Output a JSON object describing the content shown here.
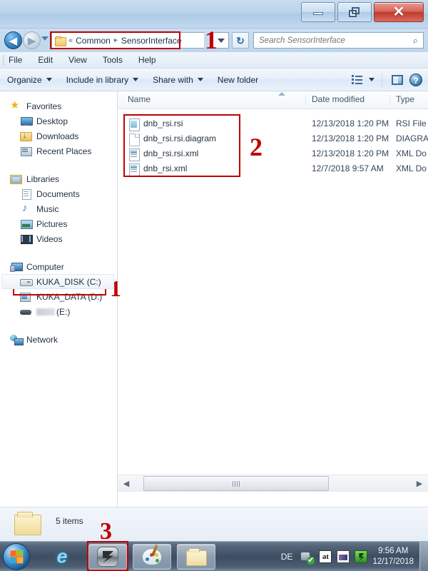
{
  "window": {
    "buttons": {
      "minimize": "minimize",
      "maximize": "maximize",
      "close": "close",
      "close_glyph": "✕"
    }
  },
  "address_bar": {
    "back_glyph": "◀",
    "forward_glyph": "▶",
    "chevrons": "«",
    "crumbs": [
      "Common",
      "SensorInterface"
    ],
    "separator": "▸",
    "refresh_glyph": "↻"
  },
  "search": {
    "placeholder": "Search SensorInterface",
    "value": "",
    "icon_glyph": "⌕"
  },
  "menubar": {
    "items": [
      "File",
      "Edit",
      "View",
      "Tools",
      "Help"
    ]
  },
  "toolbar": {
    "items": [
      {
        "label": "Organize",
        "has_caret": true
      },
      {
        "label": "Include in library",
        "has_caret": true
      },
      {
        "label": "Share with",
        "has_caret": true
      },
      {
        "label": "New folder",
        "has_caret": false
      }
    ],
    "help_glyph": "?"
  },
  "nav_pane": {
    "groups": [
      {
        "head": {
          "label": "Favorites",
          "icon": "star-icon"
        },
        "children": [
          {
            "label": "Desktop",
            "icon": "desktop-icon"
          },
          {
            "label": "Downloads",
            "icon": "downloads-icon"
          },
          {
            "label": "Recent Places",
            "icon": "recent-places-icon"
          }
        ]
      },
      {
        "head": {
          "label": "Libraries",
          "icon": "libraries-icon"
        },
        "children": [
          {
            "label": "Documents",
            "icon": "documents-icon"
          },
          {
            "label": "Music",
            "icon": "music-icon"
          },
          {
            "label": "Pictures",
            "icon": "pictures-icon"
          },
          {
            "label": "Videos",
            "icon": "videos-icon"
          }
        ]
      },
      {
        "head": {
          "label": "Computer",
          "icon": "computer-icon"
        },
        "children": [
          {
            "label": "KUKA_DISK (C:)",
            "icon": "hard-drive-icon",
            "selected": true
          },
          {
            "label": "KUKA_DATA (D:)",
            "icon": "network-drive-icon"
          },
          {
            "label": "(E:)",
            "icon": "removable-drive-icon",
            "redacted": true
          }
        ]
      },
      {
        "head": {
          "label": "Network",
          "icon": "network-icon"
        },
        "children": []
      }
    ]
  },
  "file_list": {
    "columns": [
      "Name",
      "Date modified",
      "Type"
    ],
    "sort_column": "Name",
    "sort_direction": "ascending",
    "rows": [
      {
        "name": "dnb_rsi.rsi",
        "date": "12/13/2018 1:20 PM",
        "type": "RSI File",
        "icon": "rsi-file-icon"
      },
      {
        "name": "dnb_rsi.rsi.diagram",
        "date": "12/13/2018 1:20 PM",
        "type": "DIAGRA",
        "icon": "generic-file-icon"
      },
      {
        "name": "dnb_rsi.rsi.xml",
        "date": "12/13/2018 1:20 PM",
        "type": "XML Do",
        "icon": "xml-file-icon"
      },
      {
        "name": "dnb_rsi.xml",
        "date": "12/7/2018 9:57 AM",
        "type": "XML Do",
        "icon": "xml-file-icon"
      }
    ]
  },
  "scrollbar": {
    "left_glyph": "◀",
    "right_glyph": "▶"
  },
  "status_bar": {
    "item_count": "5 items"
  },
  "taskbar": {
    "start_label": "Start",
    "buttons": [
      {
        "name": "internet-explorer",
        "label": "Internet Explorer",
        "glyph": "e"
      },
      {
        "name": "kuka-app",
        "label": "KUKA Application"
      },
      {
        "name": "paint",
        "label": "Paint"
      },
      {
        "name": "windows-explorer",
        "label": "Windows Explorer"
      }
    ],
    "tray": {
      "language": "DE",
      "icons": [
        "network-icon",
        "at-icon",
        "image-icon",
        "kuka-tray-icon"
      ],
      "at_text": "at",
      "time": "9:56 AM",
      "date": "12/17/2018"
    }
  },
  "annotations": [
    {
      "number": "1",
      "target": "address-bar-breadcrumb"
    },
    {
      "number": "2",
      "target": "file-list-items"
    },
    {
      "number": "1",
      "target": "kuka-disk-c-drive"
    },
    {
      "number": "3",
      "target": "taskbar-kuka-button"
    }
  ],
  "colors": {
    "annotation_red": "#c00000",
    "title_bar": "#bcd3ea",
    "taskbar": "#3d4d62"
  }
}
